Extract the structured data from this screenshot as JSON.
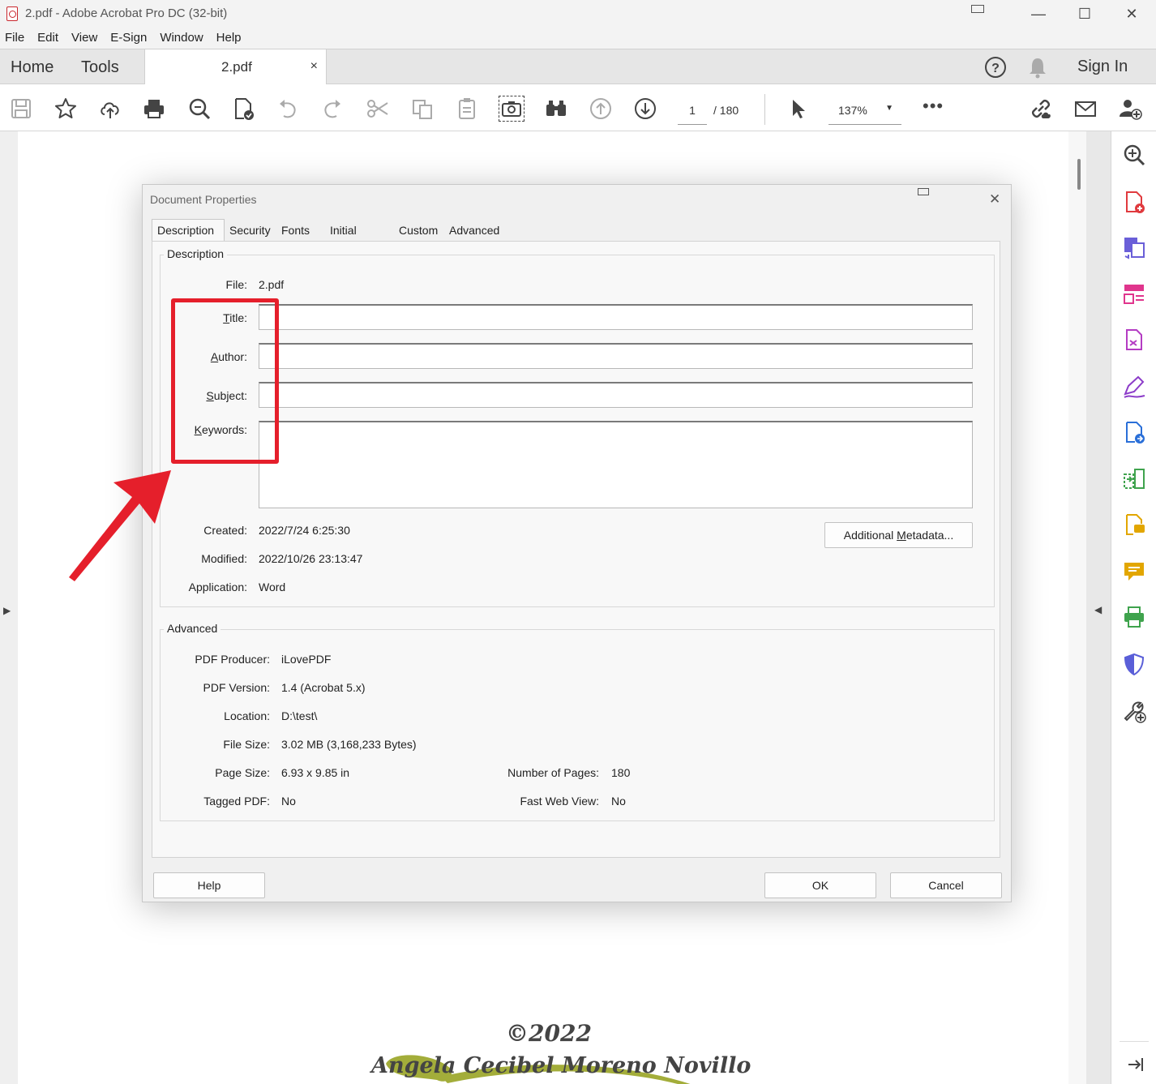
{
  "window": {
    "title": "2.pdf - Adobe Acrobat Pro DC (32-bit)",
    "minimize": "—",
    "maximize": "☐",
    "close": "✕"
  },
  "menu": [
    "File",
    "Edit",
    "View",
    "E-Sign",
    "Window",
    "Help"
  ],
  "tabbar": {
    "home": "Home",
    "tools": "Tools",
    "doc_tab": "2.pdf",
    "doc_tab_close": "×",
    "sign_in": "Sign In"
  },
  "toolbar": {
    "page_current": "1",
    "page_total": "/  180",
    "zoom": "137%",
    "zoom_caret": "▼",
    "more": "•••"
  },
  "document": {
    "copyright": "©2022",
    "author_line": "Angela Cecibel Moreno Novillo",
    "swoosh_color": "#a3ad3a"
  },
  "dialog": {
    "title": "Document Properties",
    "tabs": [
      "Description",
      "Security",
      "Fonts",
      "Initial View",
      "Custom",
      "Advanced"
    ],
    "active_tab": "Description",
    "description_group": "Description",
    "file_label": "File:",
    "file_value": "2.pdf",
    "title_label": "itle:",
    "title_mnemonic": "T",
    "title_value": "",
    "author_label": "uthor:",
    "author_mnemonic": "A",
    "author_value": "",
    "subject_label": "ubject:",
    "subject_mnemonic": "S",
    "subject_value": "",
    "keywords_label": "eywords:",
    "keywords_mnemonic": "K",
    "keywords_value": "",
    "created_label": "Created:",
    "created_value": "2022/7/24 6:25:30",
    "modified_label": "Modified:",
    "modified_value": "2022/10/26 23:13:47",
    "application_label": "Application:",
    "application_value": "Word",
    "additional_metadata_pre": "Additional ",
    "additional_metadata_mnemonic": "M",
    "additional_metadata_post": "etadata...",
    "advanced_group": "Advanced",
    "pdf_producer_label": "PDF Producer:",
    "pdf_producer_value": "iLovePDF",
    "pdf_version_label": "PDF Version:",
    "pdf_version_value": "1.4 (Acrobat 5.x)",
    "location_label": "Location:",
    "location_value": "D:\\test\\",
    "file_size_label": "File Size:",
    "file_size_value": "3.02 MB (3,168,233 Bytes)",
    "page_size_label": "Page Size:",
    "page_size_value": "6.93 x 9.85 in",
    "num_pages_label": "Number of Pages:",
    "num_pages_value": "180",
    "tagged_label": "Tagged PDF:",
    "tagged_value": "No",
    "fast_web_label": "Fast Web View:",
    "fast_web_value": "No",
    "help_button": "Help",
    "ok_button": "OK",
    "cancel_button": "Cancel"
  },
  "colors": {
    "annotation_red": "#e51f2b",
    "acrobat_red": "#c9272d"
  }
}
